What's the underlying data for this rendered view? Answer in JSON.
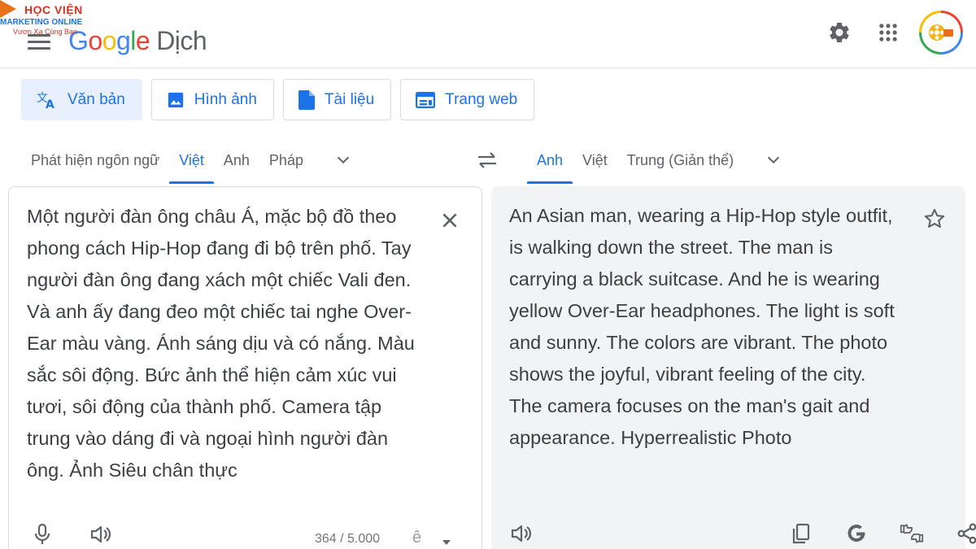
{
  "watermark": {
    "title": "HỌC VIỆN",
    "subtitle": "MARKETING ONLINE",
    "slogan": "Vươn Xa Cùng Bạn"
  },
  "header": {
    "logo_letters": [
      "G",
      "o",
      "o",
      "g",
      "l",
      "e"
    ],
    "product": "Dịch",
    "icons": [
      "gear-icon",
      "apps-grid-icon",
      "avatar"
    ]
  },
  "modes": [
    {
      "label": "Văn bản",
      "icon": "translate-icon",
      "active": true
    },
    {
      "label": "Hình ảnh",
      "icon": "image-icon",
      "active": false
    },
    {
      "label": "Tài liệu",
      "icon": "document-icon",
      "active": false
    },
    {
      "label": "Trang web",
      "icon": "web-icon",
      "active": false
    }
  ],
  "source_langs": {
    "detect": "Phát hiện ngôn ngữ",
    "items": [
      "Việt",
      "Anh",
      "Pháp"
    ],
    "active": "Việt"
  },
  "target_langs": {
    "items": [
      "Anh",
      "Việt",
      "Trung (Giản thể)"
    ],
    "active": "Anh"
  },
  "source_text": "Một người đàn ông châu Á, mặc bộ đồ theo phong cách Hip-Hop đang đi bộ trên phố. Tay người đàn ông đang xách một chiếc Vali đen. Và anh ấy đang đeo một chiếc tai nghe Over-Ear màu vàng. Ánh sáng dịu và có nắng. Màu sắc sôi động. Bức ảnh thể hiện cảm xúc vui tươi, sôi động của thành phố. Camera tập trung vào dáng đi và ngoại hình người đàn ông. Ảnh Siêu chân thực",
  "target_text": "An Asian man, wearing a Hip-Hop style outfit, is walking down the street. The man is carrying a black suitcase. And he is wearing yellow Over-Ear headphones. The light is soft and sunny. The colors are vibrant. The photo shows the joyful, vibrant feeling of the city. The camera focuses on the man's gait and appearance. Hyperrealistic Photo",
  "char_count": "364 / 5.000",
  "ime_glyph": "ê",
  "colors": {
    "accent": "#1a73e8",
    "active_tab_bg": "#e8f0fe",
    "target_panel_bg": "#f1f3f4"
  }
}
